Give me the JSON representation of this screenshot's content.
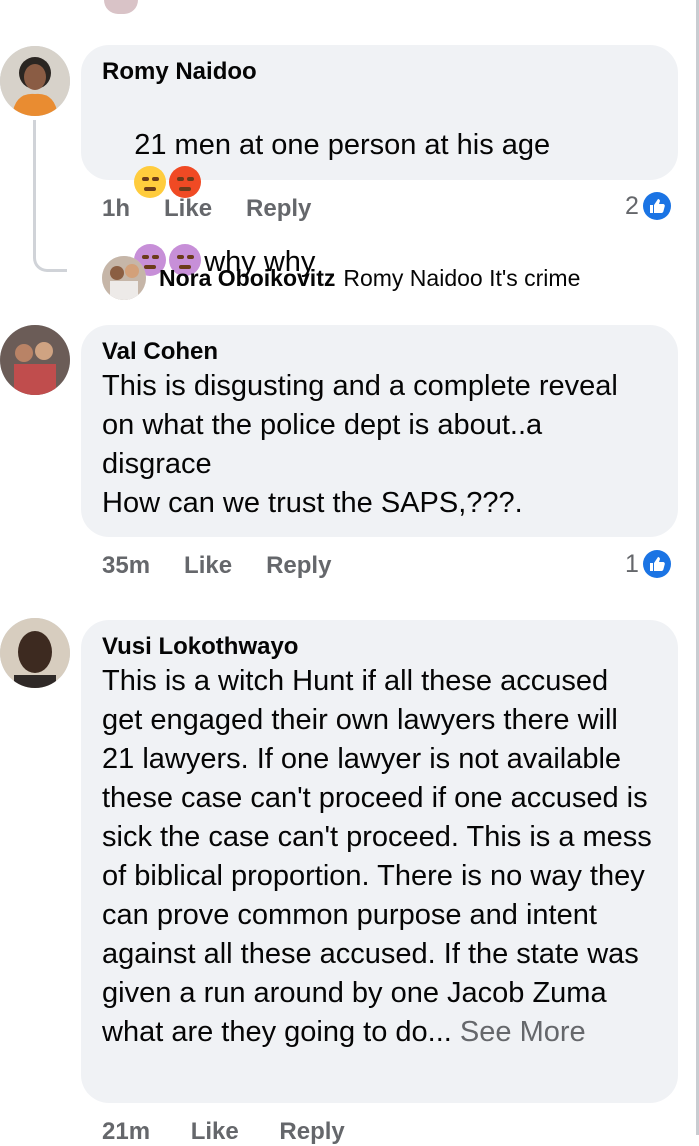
{
  "comments": [
    {
      "author": "Romy Naidoo",
      "text": "21 men at one person at his age",
      "text_line2": "why why",
      "time": "1h",
      "like_label": "Like",
      "reply_label": "Reply",
      "reactions": "2"
    },
    {
      "author": "Val Cohen",
      "text": "This is disgusting and a complete reveal on what the police dept is about..a disgrace\nHow can we trust the SAPS,???.",
      "time": "35m",
      "like_label": "Like",
      "reply_label": "Reply",
      "reactions": "1"
    },
    {
      "author": "Vusi Lokothwayo",
      "text": "This is a witch Hunt if all these accused get engaged their own lawyers there will 21 lawyers. If one lawyer is not available these case can't proceed if one accused is sick the case can't proceed. This is a mess of biblical proportion. There is no way they can prove common purpose and intent against all these accused. If the state was given a run around by one Jacob Zuma what are they going to do... ",
      "see_more": "See More",
      "time": "21m",
      "like_label": "Like",
      "reply_label": "Reply"
    }
  ],
  "reply": {
    "author": "Nora Oboikovitz",
    "text": "Romy Naidoo It's crime"
  },
  "icons": {
    "reaction": "like-thumb-icon",
    "emoji_1": "worried-face-icon",
    "emoji_2": "angry-face-icon",
    "emoji_3": "tired-face-icon",
    "emoji_4": "tired-face-icon"
  },
  "colors": {
    "bubble": "#f0f2f5",
    "meta": "#65676b",
    "like_blue": "#1b74e4"
  }
}
